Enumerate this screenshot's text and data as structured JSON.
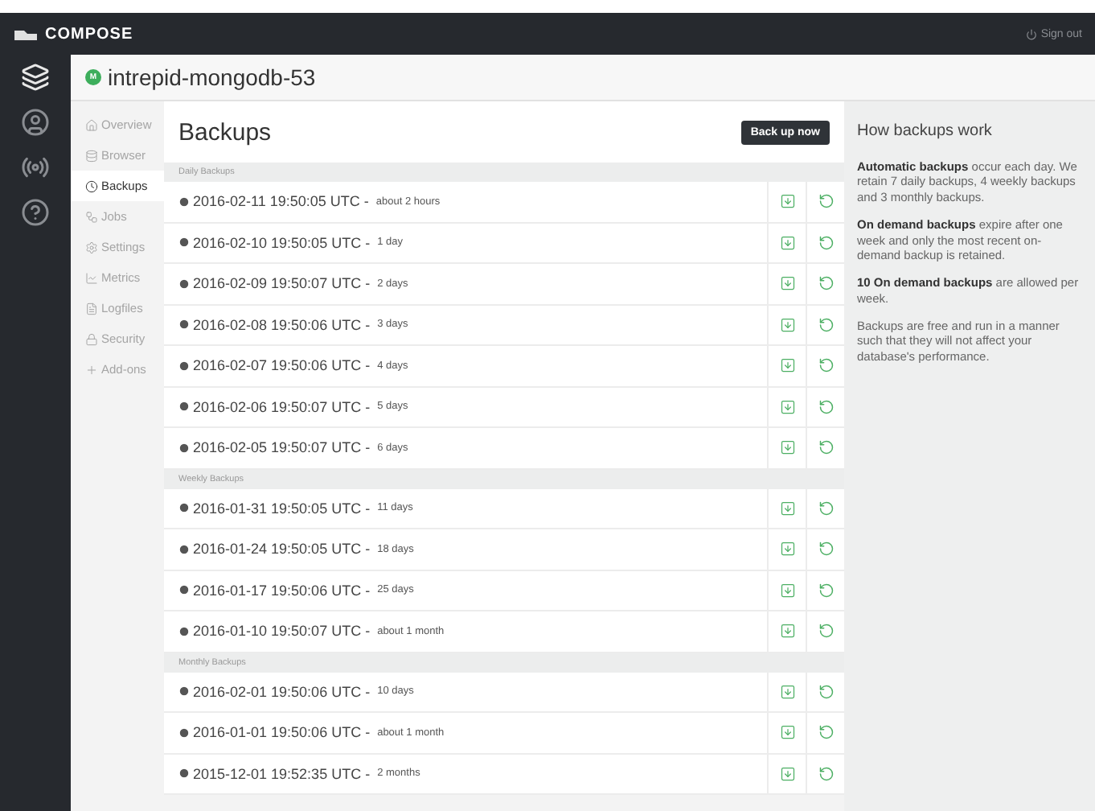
{
  "topbar": {
    "brand": "COMPOSE",
    "sign_out": "Sign out"
  },
  "rail": [
    {
      "selected": true
    },
    {
      "selected": false
    },
    {
      "selected": false
    },
    {
      "selected": false
    }
  ],
  "deployment": {
    "badge": "M",
    "name": "intrepid-mongodb-53"
  },
  "nav": [
    {
      "label": "Overview",
      "selected": false
    },
    {
      "label": "Browser",
      "selected": false
    },
    {
      "label": "Backups",
      "selected": true
    },
    {
      "label": "Jobs",
      "selected": false
    },
    {
      "label": "Settings",
      "selected": false
    },
    {
      "label": "Metrics",
      "selected": false
    },
    {
      "label": "Logfiles",
      "selected": false
    },
    {
      "label": "Security",
      "selected": false
    },
    {
      "label": "Add-ons",
      "selected": false
    }
  ],
  "main": {
    "title": "Backups",
    "button": "Back up now",
    "sections": [
      {
        "heading": "Daily Backups",
        "rows": [
          {
            "date": "2016-02-11 19:50:05 UTC - ",
            "age": "about 2 hours"
          },
          {
            "date": "2016-02-10 19:50:05 UTC - ",
            "age": "1 day"
          },
          {
            "date": "2016-02-09 19:50:07 UTC - ",
            "age": "2 days"
          },
          {
            "date": "2016-02-08 19:50:06 UTC - ",
            "age": "3 days"
          },
          {
            "date": "2016-02-07 19:50:06 UTC - ",
            "age": "4 days"
          },
          {
            "date": "2016-02-06 19:50:07 UTC - ",
            "age": "5 days"
          },
          {
            "date": "2016-02-05 19:50:07 UTC - ",
            "age": "6 days"
          }
        ]
      },
      {
        "heading": "Weekly Backups",
        "rows": [
          {
            "date": "2016-01-31 19:50:05 UTC - ",
            "age": "11 days"
          },
          {
            "date": "2016-01-24 19:50:05 UTC - ",
            "age": "18 days"
          },
          {
            "date": "2016-01-17 19:50:06 UTC - ",
            "age": "25 days"
          },
          {
            "date": "2016-01-10 19:50:07 UTC - ",
            "age": "about 1 month"
          }
        ]
      },
      {
        "heading": "Monthly Backups",
        "rows": [
          {
            "date": "2016-02-01 19:50:06 UTC - ",
            "age": "10 days"
          },
          {
            "date": "2016-01-01 19:50:06 UTC - ",
            "age": "about 1 month"
          },
          {
            "date": "2015-12-01 19:52:35 UTC - ",
            "age": "2 months"
          }
        ]
      }
    ]
  },
  "help": {
    "title": "How backups work",
    "paragraphs": [
      "**Automatic backups** occur each day. We retain 7 daily backups, 4 weekly backups and 3 monthly backups.",
      "**On demand backups** expire after one week and only the most recent on-demand backup is retained.",
      "**10 On demand backups** are allowed per week.",
      "Backups are free and run in a manner such that they will not affect your database's performance."
    ]
  }
}
